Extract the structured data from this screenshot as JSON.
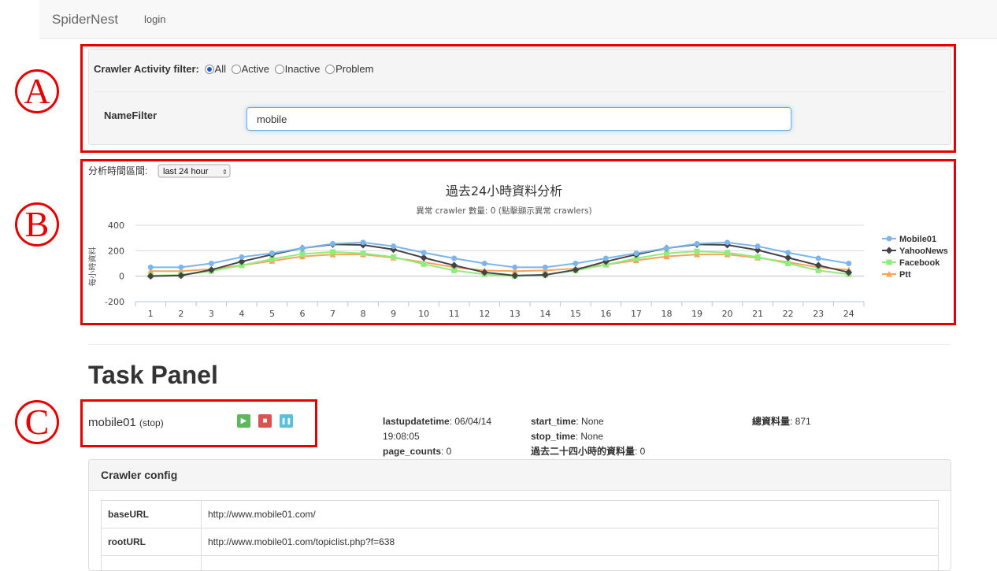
{
  "navbar": {
    "brand": "SpiderNest",
    "login": "login"
  },
  "filters": {
    "activity_label": "Crawler Activity filter:",
    "options": [
      {
        "label": "All",
        "selected": true
      },
      {
        "label": "Active",
        "selected": false
      },
      {
        "label": "Inactive",
        "selected": false
      },
      {
        "label": "Problem",
        "selected": false
      }
    ],
    "name_label": "NameFilter",
    "name_value": "mobile"
  },
  "chart_section": {
    "range_label": "分析時間區間:",
    "range_select": "last 24 hour"
  },
  "chart_data": {
    "type": "line",
    "title": "過去24小時資料分析",
    "subtitle": "異常 crawler 數量: 0 (點擊顯示異常 crawlers)",
    "ylabel": "每小時資料",
    "xlabel": "",
    "ylim": [
      -200,
      400
    ],
    "yticks": [
      -200,
      0,
      200,
      400
    ],
    "grid": true,
    "legend_position": "right",
    "categories": [
      "1",
      "2",
      "3",
      "4",
      "5",
      "6",
      "7",
      "8",
      "9",
      "10",
      "11",
      "12",
      "13",
      "14",
      "15",
      "16",
      "17",
      "18",
      "19",
      "20",
      "21",
      "22",
      "23",
      "24"
    ],
    "series": [
      {
        "name": "Mobile01",
        "color": "#7cb5ec",
        "marker": "circle",
        "values": [
          70,
          70,
          100,
          150,
          180,
          220,
          255,
          265,
          235,
          185,
          140,
          100,
          70,
          70,
          100,
          140,
          180,
          220,
          255,
          265,
          235,
          185,
          140,
          100
        ]
      },
      {
        "name": "YahooNews",
        "color": "#434348",
        "marker": "diamond",
        "values": [
          0,
          5,
          50,
          115,
          170,
          220,
          250,
          245,
          210,
          145,
          85,
          30,
          5,
          10,
          50,
          115,
          170,
          220,
          250,
          245,
          205,
          145,
          85,
          30
        ]
      },
      {
        "name": "Facebook",
        "color": "#90ed7d",
        "marker": "square",
        "values": [
          5,
          10,
          40,
          85,
          135,
          175,
          190,
          180,
          150,
          95,
          45,
          15,
          0,
          10,
          45,
          90,
          140,
          180,
          195,
          185,
          150,
          100,
          45,
          15
        ]
      },
      {
        "name": "Ptt",
        "color": "#f7a35c",
        "marker": "triangle",
        "values": [
          40,
          40,
          55,
          85,
          120,
          155,
          170,
          170,
          145,
          110,
          70,
          45,
          40,
          45,
          60,
          90,
          125,
          155,
          170,
          170,
          145,
          110,
          70,
          50
        ]
      }
    ]
  },
  "annotations": {
    "a": "A",
    "b": "B",
    "c": "C"
  },
  "task_panel": {
    "title": "Task Panel",
    "task_name": "mobile01",
    "task_state": "(stop)",
    "buttons": {
      "play": "▶",
      "stop": "■",
      "pause": "❚❚"
    },
    "stats": {
      "lastupdatetime_label": "lastupdatetime",
      "lastupdatetime_value": ": 06/04/14",
      "lastupdatetime_value2": "19:08:05",
      "page_counts_label": "page_counts",
      "page_counts_value": ": 0",
      "start_time_label": "start_time",
      "start_time_value": ": None",
      "stop_time_label": "stop_time",
      "stop_time_value": ": None",
      "past24_label": "過去二十四小時的資料量",
      "past24_value": ": 0",
      "total_label": "總資料量",
      "total_value": ": 871"
    }
  },
  "config": {
    "title": "Crawler config",
    "rows": [
      {
        "key": "baseURL",
        "value": "http://www.mobile01.com/"
      },
      {
        "key": "rootURL",
        "value": "http://www.mobile01.com/topiclist.php?f=638"
      }
    ]
  }
}
